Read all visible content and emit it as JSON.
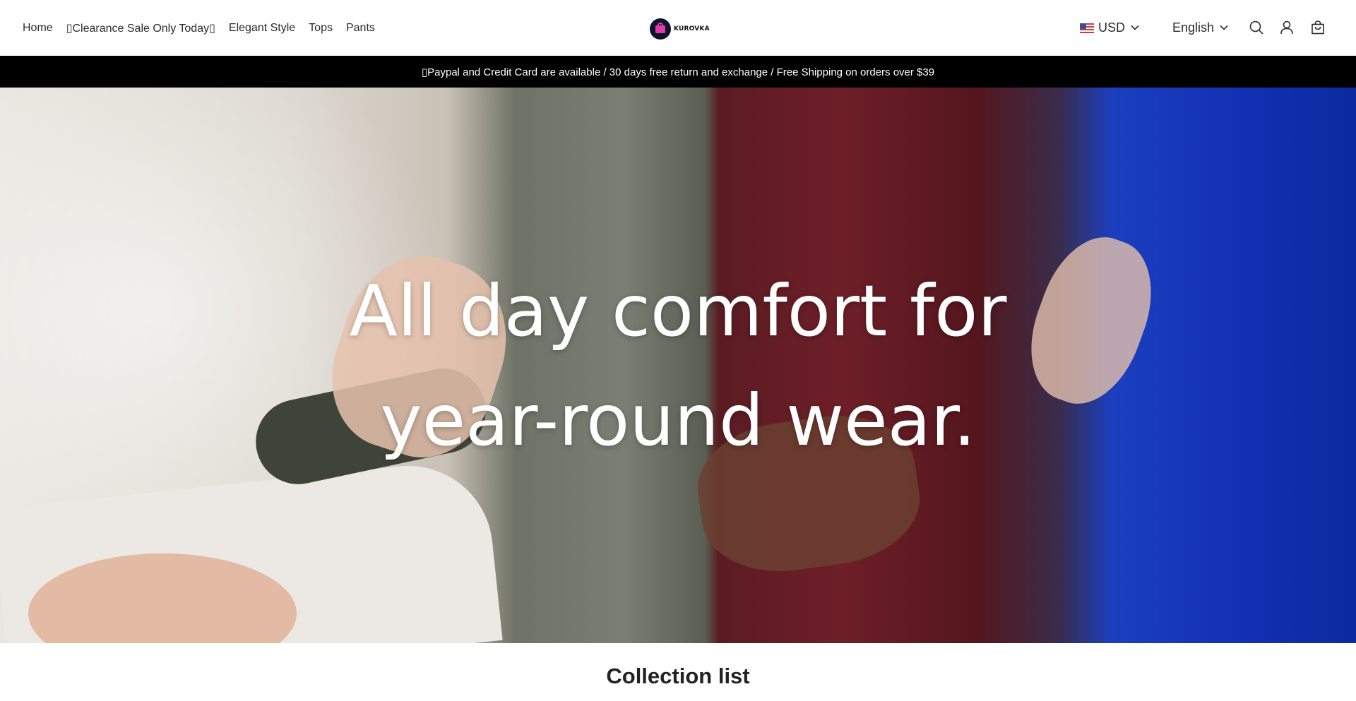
{
  "nav": {
    "items": [
      {
        "label": "Home"
      },
      {
        "label": "▯​Clearance Sale Only Today▯"
      },
      {
        "label": "Elegant Style"
      },
      {
        "label": "Tops"
      },
      {
        "label": "Pants"
      }
    ]
  },
  "brand": {
    "name": "KUROVKA",
    "logo_colors": {
      "circle": "#0e1430",
      "bag": "#e23aa0"
    }
  },
  "header_controls": {
    "currency": "USD",
    "currency_flag": "us-flag-icon",
    "language": "English",
    "icons": [
      "search-icon",
      "account-icon",
      "cart-icon"
    ]
  },
  "announcement": {
    "text": "▯Paypal and Credit Card are available / 30 days free return and exchange / Free Shipping on orders over $39"
  },
  "hero": {
    "line1": "All day comfort for",
    "line2": "year-round wear."
  },
  "collection": {
    "title": "Collection list"
  },
  "colors": {
    "announcement_bg": "#000000",
    "announcement_text": "#ffffff",
    "header_bg": "#ffffff"
  }
}
